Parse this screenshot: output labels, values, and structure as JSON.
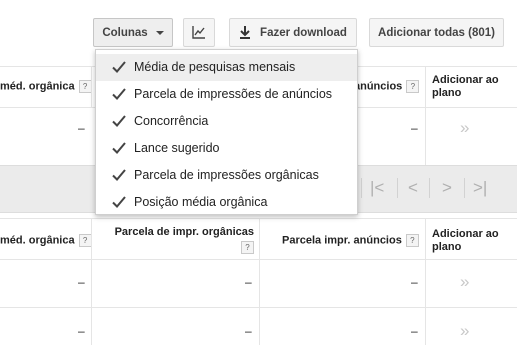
{
  "toolbar": {
    "columns_label": "Colunas",
    "download_label": "Fazer download",
    "add_all_label": "Adicionar todas (801)"
  },
  "columns_menu": {
    "items": [
      {
        "label": "Média de pesquisas mensais",
        "checked": true,
        "highlighted": true
      },
      {
        "label": "Parcela de impressões de anúncios",
        "checked": true
      },
      {
        "label": "Concorrência",
        "checked": true
      },
      {
        "label": "Lance sugerido",
        "checked": true
      },
      {
        "label": "Parcela de impressões orgânicas",
        "checked": true
      },
      {
        "label": "Posição média orgânica",
        "checked": true
      }
    ]
  },
  "table_top": {
    "headers": {
      "organic_pos": "méd. orgânica",
      "ad_impr": "anúncios",
      "add_to_plan": "Adicionar ao plano"
    },
    "row": {
      "organic_pos": "–",
      "ad_impr": "–",
      "add": "»"
    }
  },
  "pager": {
    "first": "|<",
    "prev": "<",
    "next": ">",
    "last": ">|"
  },
  "table_bottom": {
    "headers": {
      "organic_pos": "méd. orgânica",
      "organic_impr": "Parcela de impr. orgânicas",
      "ad_impr": "Parcela impr. anúncios",
      "add_to_plan": "Adicionar ao plano"
    },
    "help": "?",
    "rows": [
      {
        "organic_pos": "–",
        "organic_impr": "–",
        "ad_impr": "–",
        "add": "»"
      },
      {
        "organic_pos": "–",
        "organic_impr": "–",
        "ad_impr": "–",
        "add": "»"
      }
    ]
  }
}
